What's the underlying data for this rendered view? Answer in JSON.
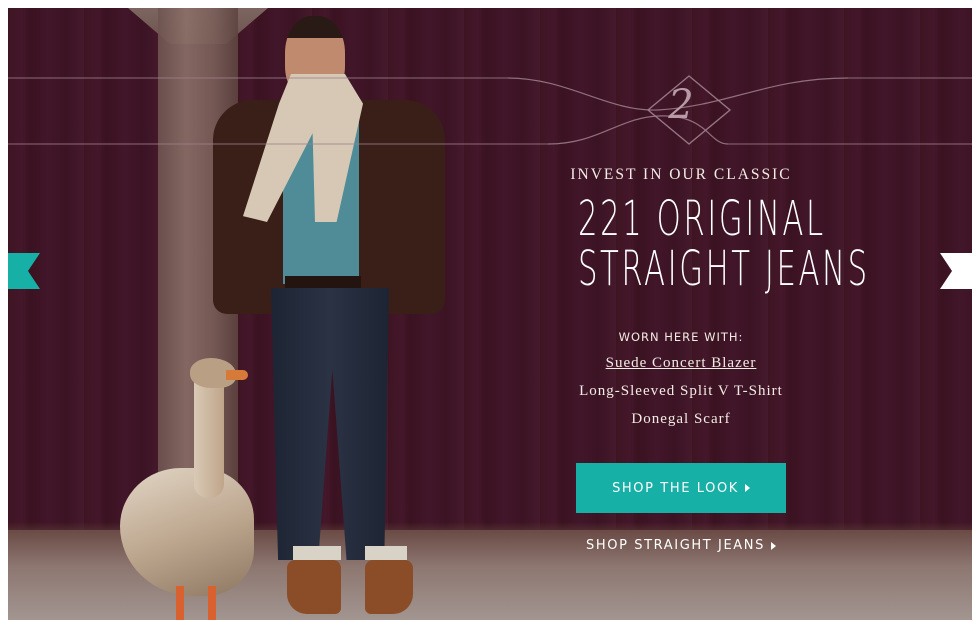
{
  "slide": {
    "number": "2",
    "kicker": "INVEST IN OUR CLASSIC",
    "headline_line1": "221 ORIGINAL",
    "headline_line2": "STRAIGHT JEANS",
    "worn_label": "WORN HERE WITH:",
    "items": [
      {
        "label": "Suede Concert Blazer",
        "linked": true
      },
      {
        "label": "Long-Sleeved Split V T-Shirt",
        "linked": false
      },
      {
        "label": "Donegal Scarf",
        "linked": false
      }
    ],
    "cta_label": "SHOP THE LOOK",
    "secondary_label": "SHOP STRAIGHT JEANS"
  },
  "navigation": {
    "prev_icon": "ribbon-arrow-left-icon",
    "next_icon": "ribbon-arrow-right-icon"
  },
  "colors": {
    "accent": "#17b0a6",
    "background": "#40152a",
    "text": "#f3ece6",
    "ornament": "#a07f8e"
  }
}
